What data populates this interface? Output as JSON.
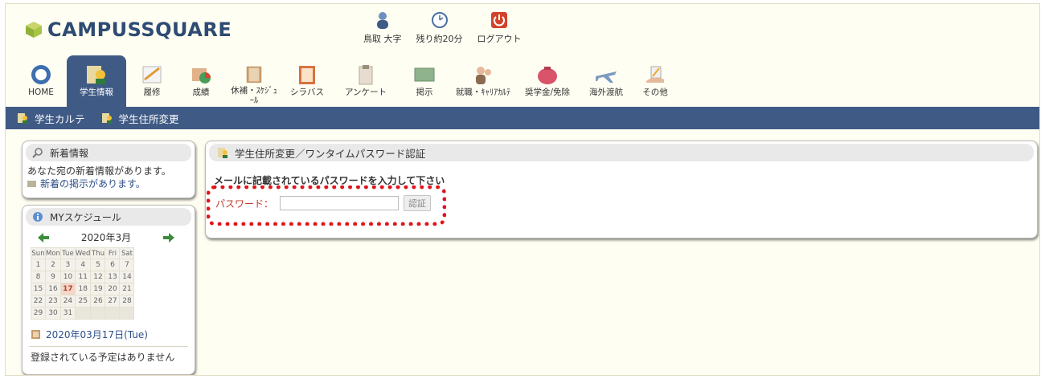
{
  "header": {
    "logo_text": "CAMPUSSQUARE",
    "user_name": "鳥取 大字",
    "time_remaining": "残り約20分",
    "logout_label": "ログアウト"
  },
  "nav": [
    {
      "label": "HOME",
      "icon": "home-icon"
    },
    {
      "label": "学生情報",
      "icon": "student-info-icon",
      "active": true
    },
    {
      "label": "履修",
      "icon": "registration-icon"
    },
    {
      "label": "成績",
      "icon": "grades-icon"
    },
    {
      "label": "休補・ｽｹｼﾞｭｰﾙ",
      "icon": "schedule-icon"
    },
    {
      "label": "シラバス",
      "icon": "syllabus-icon"
    },
    {
      "label": "アンケート",
      "icon": "survey-icon"
    },
    {
      "label": "掲示",
      "icon": "bulletin-icon"
    },
    {
      "label": "就職・ｷｬﾘｱｶﾙﾃ",
      "icon": "career-icon"
    },
    {
      "label": "奨学金/免除",
      "icon": "scholarship-icon"
    },
    {
      "label": "海外渡航",
      "icon": "airplane-icon"
    },
    {
      "label": "その他",
      "icon": "other-icon"
    }
  ],
  "subnav": [
    "学生カルテ",
    "学生住所変更"
  ],
  "news": {
    "title": "新着情報",
    "message": "あなた宛の新着情報があります。",
    "link": "新着の掲示があります。"
  },
  "schedule": {
    "title": "MYスケジュール",
    "month": "2020年3月",
    "weekdays": [
      "Sun",
      "Mon",
      "Tue",
      "Wed",
      "Thu",
      "Fri",
      "Sat"
    ],
    "weeks": [
      [
        "1",
        "2",
        "3",
        "4",
        "5",
        "6",
        "7"
      ],
      [
        "8",
        "9",
        "10",
        "11",
        "12",
        "13",
        "14"
      ],
      [
        "15",
        "16",
        "17",
        "18",
        "19",
        "20",
        "21"
      ],
      [
        "22",
        "23",
        "24",
        "25",
        "26",
        "27",
        "28"
      ],
      [
        "29",
        "30",
        "31",
        "",
        "",
        "",
        ""
      ]
    ],
    "today": "17",
    "selected_date": "2020年03月17日(Tue)",
    "no_events": "登録されている予定はありません"
  },
  "main": {
    "title": "学生住所変更／ワンタイムパスワード認証",
    "instruction": "メールに記載されているパスワードを入力して下さい",
    "password_label": "パスワード：",
    "password_value": "",
    "submit_label": "認証"
  },
  "colors": {
    "brand": "#2d4b73",
    "nav_active": "#3f5a85",
    "highlight": "#e0141a",
    "page_bg": "#fffef2"
  }
}
